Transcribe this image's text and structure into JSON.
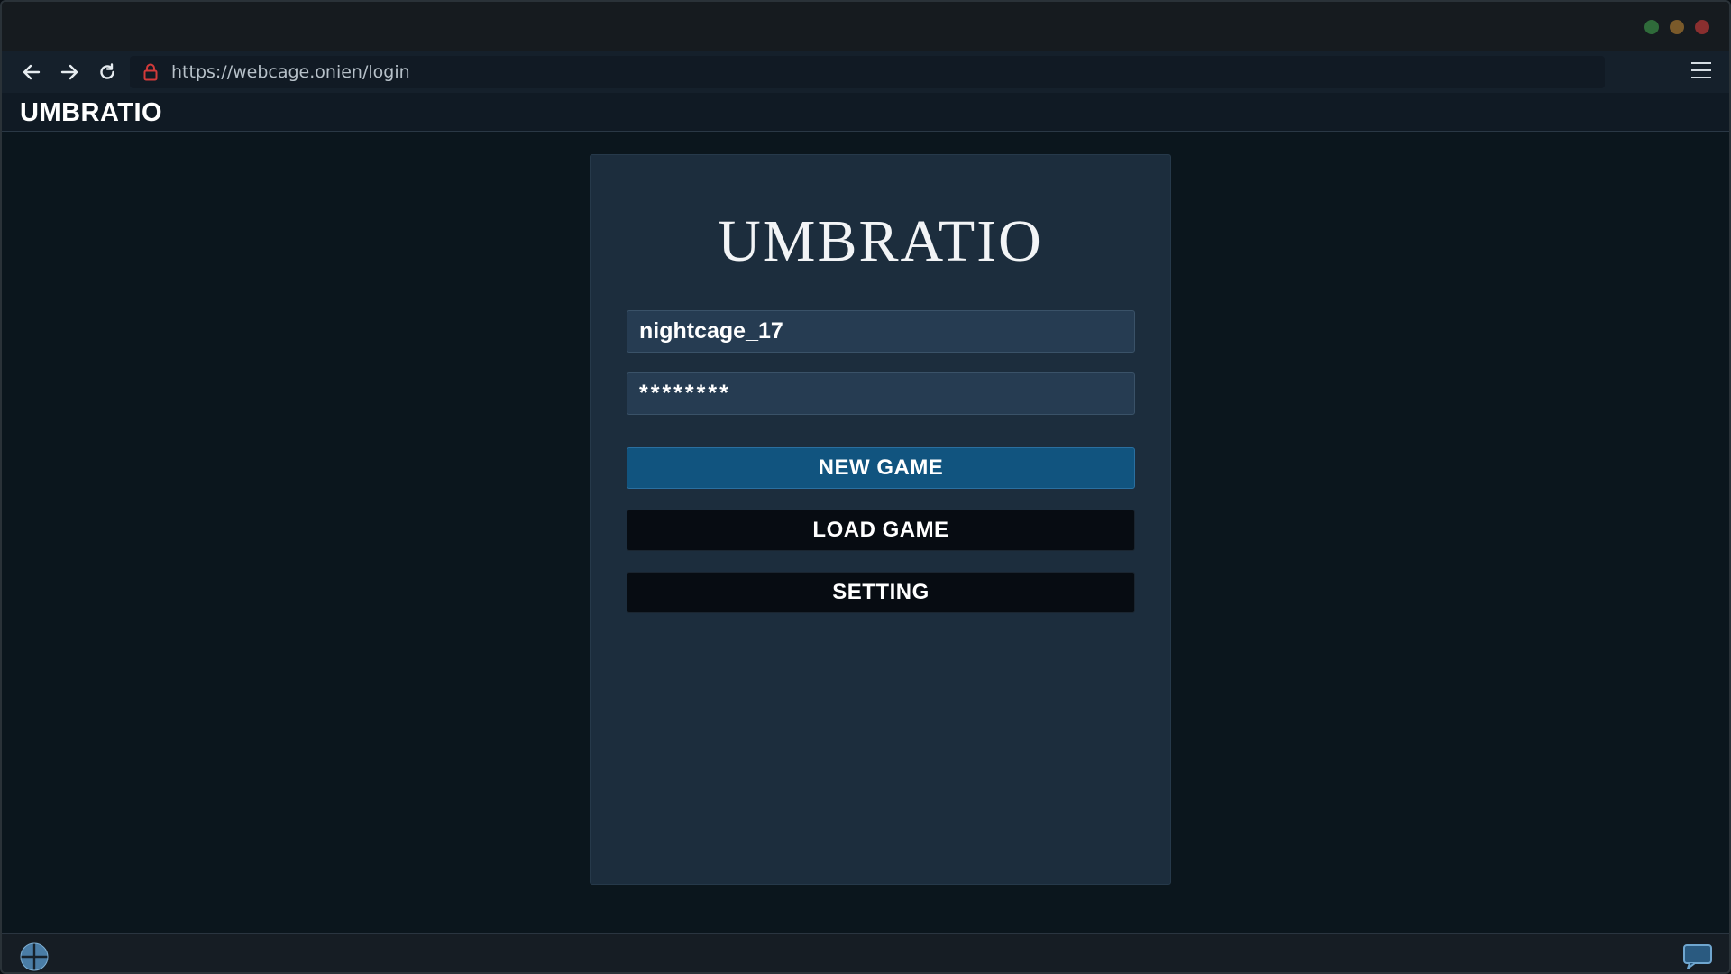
{
  "window": {
    "controls": [
      "maximize-dot",
      "minimize-dot",
      "close-dot"
    ],
    "colors": {
      "dot_green": "#2f6b3a",
      "dot_orange": "#7a5a2a",
      "dot_red": "#8a2f2f"
    }
  },
  "toolbar": {
    "url": "https://webcage.onien/login",
    "icons": [
      "arrow-left-icon",
      "arrow-right-icon",
      "reload-icon",
      "lock-icon",
      "hamburger-menu-icon"
    ]
  },
  "site": {
    "logo": "UMBRATIO"
  },
  "login": {
    "title": "UMBRATIO",
    "username_value": "nightcage_17",
    "password_value": "********",
    "new_game_label": "NEW GAME",
    "load_game_label": "LOAD GAME",
    "setting_label": "SETTING"
  },
  "taskbar": {
    "icons": [
      "globe-icon",
      "chat-icon"
    ]
  },
  "colors": {
    "accent": "#11547f",
    "card_bg": "#1c2d3d",
    "page_bg": "#0b161d",
    "lock_red": "#d23a3a"
  }
}
